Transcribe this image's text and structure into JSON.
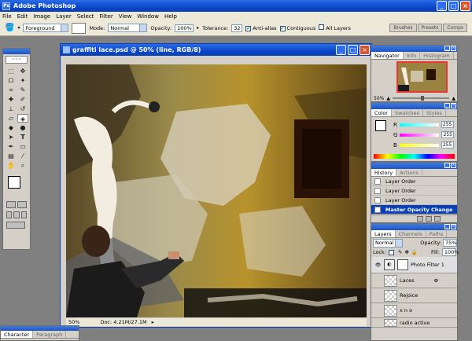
{
  "app": {
    "title": "Adobe Photoshop"
  },
  "menu": [
    "File",
    "Edit",
    "Image",
    "Layer",
    "Select",
    "Filter",
    "View",
    "Window",
    "Help"
  ],
  "options": {
    "fill_source": "Foreground",
    "mode_label": "Mode:",
    "mode_value": "Normal",
    "opacity_label": "Opacity:",
    "opacity_value": "100%",
    "tolerance_label": "Tolerance:",
    "tolerance_value": "32",
    "anti_alias": "Anti-alias",
    "contiguous": "Contiguous",
    "all_layers": "All Layers"
  },
  "panel_well_tabs": [
    "Brushes",
    "Presets",
    "Comps"
  ],
  "document": {
    "title": "graffiti lace.psd @ 50% (line, RGB/8)",
    "zoom": "50%",
    "doc_size": "Doc: 4.21M/27.1M"
  },
  "navigator": {
    "tabs": [
      "Navigator",
      "Info",
      "Histogram"
    ],
    "zoom": "50%"
  },
  "color_panel": {
    "tabs": [
      "Color",
      "Swatches",
      "Styles"
    ],
    "channels": [
      {
        "label": "R",
        "value": "255",
        "color": "#ff4040"
      },
      {
        "label": "G",
        "value": "255",
        "color": "#40c040"
      },
      {
        "label": "B",
        "value": "255",
        "color": "#4040ff"
      }
    ]
  },
  "history": {
    "tabs": [
      "History",
      "Actions"
    ],
    "items": [
      "Layer Order",
      "Layer Order",
      "Layer Order",
      "Master Opacity Change"
    ]
  },
  "layers": {
    "tabs": [
      "Layers",
      "Channels",
      "Paths"
    ],
    "blend_mode": "Normal",
    "opacity_label": "Opacity:",
    "opacity_value": "75%",
    "lock_label": "Lock:",
    "fill_label": "Fill:",
    "fill_value": "100%",
    "items": [
      "Photo Filter 1",
      "Laces",
      "Rejoice",
      "x n o",
      "radio active"
    ]
  },
  "character": {
    "tabs": [
      "Character",
      "Paragraph"
    ]
  }
}
